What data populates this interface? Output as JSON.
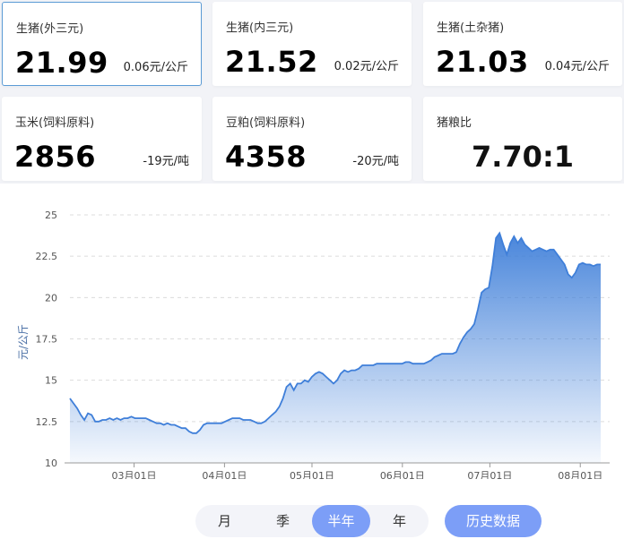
{
  "cards": [
    {
      "name": "生猪(外三元)",
      "price": "21.99",
      "change": "0.06元",
      "unit": "/公斤",
      "trend": "up",
      "icon": "arrow-up-icon"
    },
    {
      "name": "生猪(内三元)",
      "price": "21.52",
      "change": "0.02元",
      "unit": "/公斤",
      "trend": "up",
      "icon": "arrow-up-icon"
    },
    {
      "name": "生猪(土杂猪)",
      "price": "21.03",
      "change": "0.04元",
      "unit": "/公斤",
      "trend": "up",
      "icon": "arrow-up-icon"
    },
    {
      "name": "玉米(饲料原料)",
      "price": "2856",
      "change": "-19元",
      "unit": "/吨",
      "trend": "down",
      "icon": "arrow-down-icon"
    },
    {
      "name": "豆粕(饲料原料)",
      "price": "4358",
      "change": "-20元",
      "unit": "/吨",
      "trend": "down",
      "icon": "arrow-down-icon"
    }
  ],
  "ratio_card": {
    "name": "猪粮比",
    "value": "7.70:1"
  },
  "colors": {
    "up": "#e0201b",
    "down": "#22a38a",
    "line": "#3f7fd9",
    "accent": "#7c9ef7"
  },
  "chart_data": {
    "type": "area",
    "ylabel": "元/公斤",
    "ylim": [
      10,
      25
    ],
    "yticks": [
      "10",
      "12.5",
      "15",
      "17.5",
      "20",
      "22.5",
      "25"
    ],
    "grid": true,
    "xticks": [
      "03月01日",
      "04月01日",
      "05月01日",
      "06月01日",
      "07月01日",
      "08月01日"
    ],
    "x_start": "02月07日",
    "x_end": "08月07日",
    "values": [
      13.9,
      13.6,
      13.3,
      12.9,
      12.6,
      13.0,
      12.9,
      12.5,
      12.5,
      12.6,
      12.6,
      12.7,
      12.6,
      12.7,
      12.6,
      12.7,
      12.7,
      12.8,
      12.7,
      12.7,
      12.7,
      12.7,
      12.6,
      12.5,
      12.4,
      12.4,
      12.3,
      12.4,
      12.3,
      12.3,
      12.2,
      12.1,
      12.1,
      11.9,
      11.8,
      11.8,
      12.0,
      12.3,
      12.4,
      12.4,
      12.4,
      12.4,
      12.4,
      12.5,
      12.6,
      12.7,
      12.7,
      12.7,
      12.6,
      12.6,
      12.6,
      12.5,
      12.4,
      12.4,
      12.5,
      12.7,
      12.9,
      13.1,
      13.4,
      13.9,
      14.6,
      14.8,
      14.4,
      14.8,
      14.8,
      15.0,
      14.9,
      15.2,
      15.4,
      15.5,
      15.4,
      15.2,
      15.0,
      14.8,
      15.0,
      15.4,
      15.6,
      15.5,
      15.6,
      15.6,
      15.7,
      15.9,
      15.9,
      15.9,
      15.9,
      16.0,
      16.0,
      16.0,
      16.0,
      16.0,
      16.0,
      16.0,
      16.0,
      16.1,
      16.1,
      16.0,
      16.0,
      16.0,
      16.0,
      16.1,
      16.2,
      16.4,
      16.5,
      16.6,
      16.6,
      16.6,
      16.6,
      16.7,
      17.2,
      17.6,
      17.9,
      18.1,
      18.4,
      19.3,
      20.3,
      20.5,
      20.6,
      21.9,
      23.6,
      23.9,
      23.2,
      22.6,
      23.3,
      23.7,
      23.3,
      23.6,
      23.2,
      23.0,
      22.8,
      22.9,
      23.0,
      22.9,
      22.8,
      22.9,
      22.9,
      22.6,
      22.3,
      22.0,
      21.4,
      21.2,
      21.5,
      22.0,
      22.1,
      22.0,
      22.0,
      21.9,
      22.0,
      22.0
    ]
  },
  "range_tabs": [
    "月",
    "季",
    "半年",
    "年"
  ],
  "active_range": "半年",
  "history_button": "历史数据"
}
